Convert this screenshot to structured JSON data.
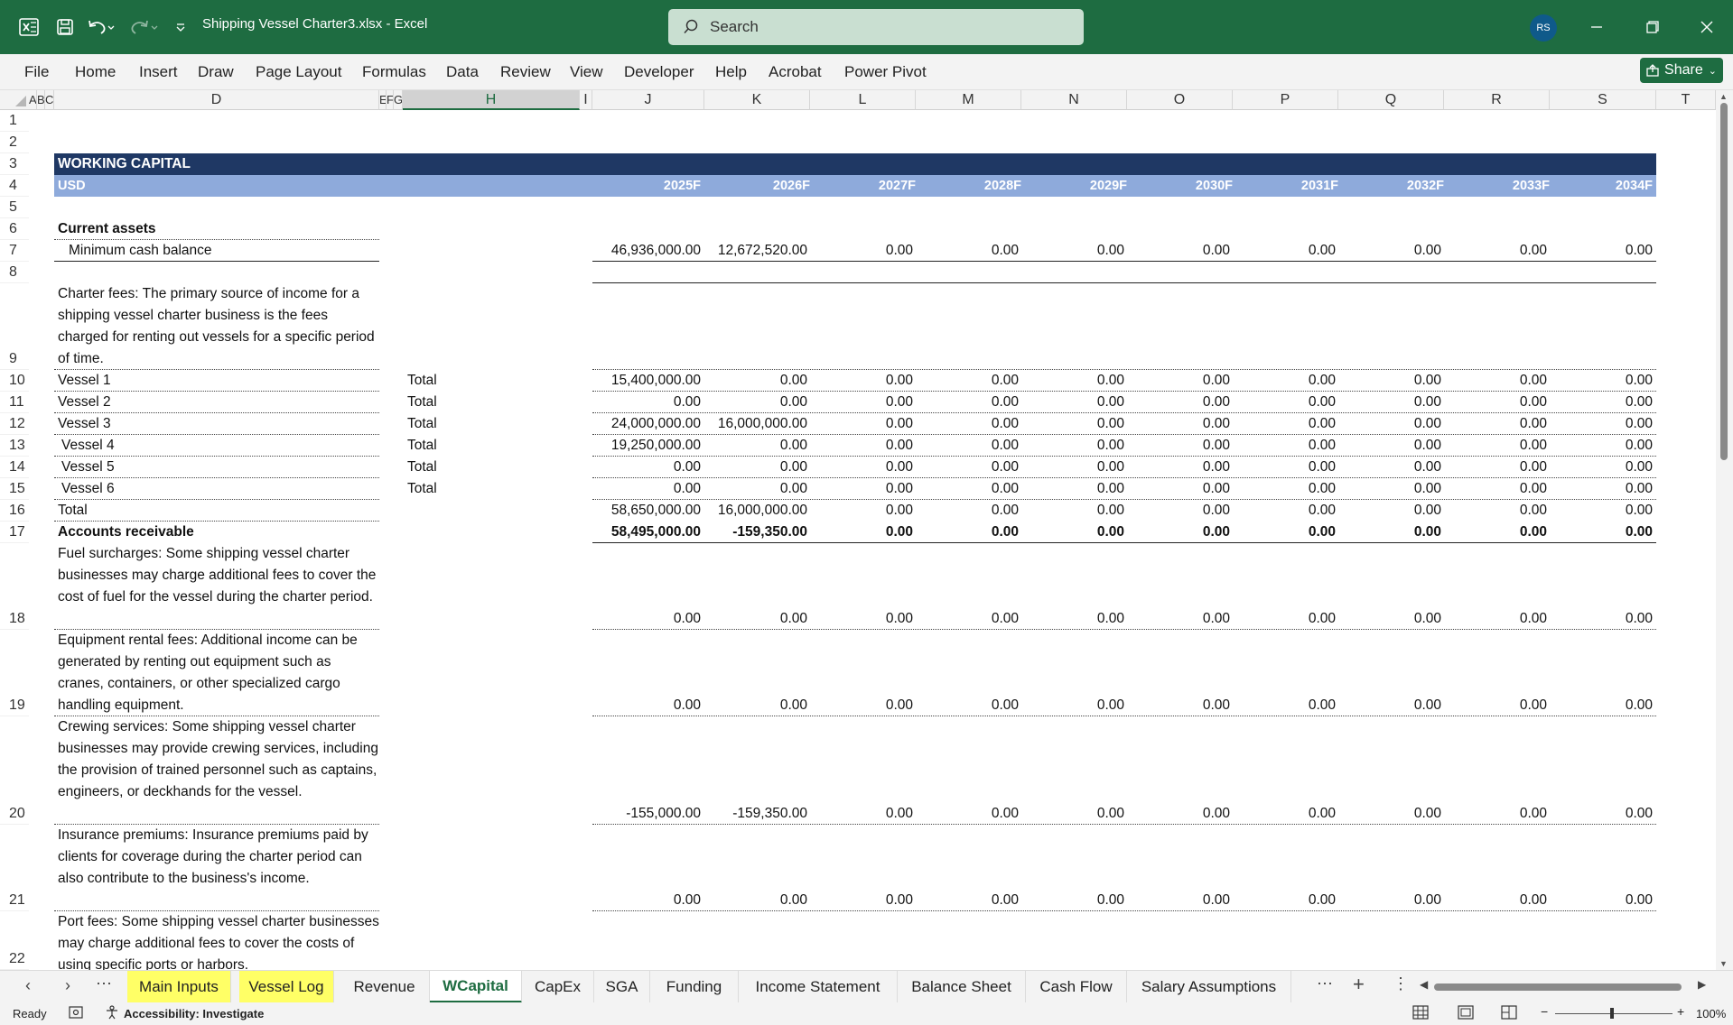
{
  "window": {
    "file_title": "Shipping Vessel Charter3.xlsx  -  Excel",
    "search_placeholder": "Search",
    "avatar_initials": "RS",
    "share_label": "Share"
  },
  "menu": [
    "File",
    "Home",
    "Insert",
    "Draw",
    "Page Layout",
    "Formulas",
    "Data",
    "Review",
    "View",
    "Developer",
    "Help",
    "Acrobat",
    "Power Pivot"
  ],
  "columns": [
    "A",
    "B",
    "C",
    "D",
    "E",
    "F",
    "G",
    "H",
    "I",
    "J",
    "K",
    "L",
    "M",
    "N",
    "O",
    "P",
    "Q",
    "R",
    "S",
    "T"
  ],
  "rows": [
    "1",
    "2",
    "3",
    "4",
    "5",
    "6",
    "7",
    "8",
    "9",
    "10",
    "11",
    "12",
    "13",
    "14",
    "15",
    "16",
    "17",
    "18",
    "19",
    "20",
    "21",
    "22"
  ],
  "sheet": {
    "header_title": "WORKING CAPITAL",
    "header_currency": "USD",
    "years": [
      "2025F",
      "2026F",
      "2027F",
      "2028F",
      "2029F",
      "2030F",
      "2031F",
      "2032F",
      "2033F",
      "2034F"
    ],
    "current_assets_label": "Current assets",
    "min_cash": {
      "label": "Minimum cash balance",
      "values": [
        "46,936,000.00",
        "12,672,520.00",
        "0.00",
        "0.00",
        "0.00",
        "0.00",
        "0.00",
        "0.00",
        "0.00",
        "0.00"
      ]
    },
    "charter_note": "Charter fees: The primary source of income for a shipping vessel charter business is the fees charged for renting out vessels for a specific period of time.",
    "vessels": [
      {
        "label": "Vessel 1",
        "h": "Total",
        "values": [
          "15,400,000.00",
          "0.00",
          "0.00",
          "0.00",
          "0.00",
          "0.00",
          "0.00",
          "0.00",
          "0.00",
          "0.00"
        ]
      },
      {
        "label": "Vessel 2",
        "h": "Total",
        "values": [
          "0.00",
          "0.00",
          "0.00",
          "0.00",
          "0.00",
          "0.00",
          "0.00",
          "0.00",
          "0.00",
          "0.00"
        ]
      },
      {
        "label": "Vessel 3",
        "h": "Total",
        "values": [
          "24,000,000.00",
          "16,000,000.00",
          "0.00",
          "0.00",
          "0.00",
          "0.00",
          "0.00",
          "0.00",
          "0.00",
          "0.00"
        ]
      },
      {
        "label": "Vessel 4",
        "h": "Total",
        "values": [
          "19,250,000.00",
          "0.00",
          "0.00",
          "0.00",
          "0.00",
          "0.00",
          "0.00",
          "0.00",
          "0.00",
          "0.00"
        ]
      },
      {
        "label": "Vessel 5",
        "h": "Total",
        "values": [
          "0.00",
          "0.00",
          "0.00",
          "0.00",
          "0.00",
          "0.00",
          "0.00",
          "0.00",
          "0.00",
          "0.00"
        ]
      },
      {
        "label": "Vessel 6",
        "h": "Total",
        "values": [
          "0.00",
          "0.00",
          "0.00",
          "0.00",
          "0.00",
          "0.00",
          "0.00",
          "0.00",
          "0.00",
          "0.00"
        ]
      }
    ],
    "total": {
      "label": "Total",
      "values": [
        "58,650,000.00",
        "16,000,000.00",
        "0.00",
        "0.00",
        "0.00",
        "0.00",
        "0.00",
        "0.00",
        "0.00",
        "0.00"
      ]
    },
    "ar": {
      "label": "Accounts receivable",
      "values": [
        "58,495,000.00",
        "-159,350.00",
        "0.00",
        "0.00",
        "0.00",
        "0.00",
        "0.00",
        "0.00",
        "0.00",
        "0.00"
      ]
    },
    "fuel": {
      "label": "Fuel surcharges: Some shipping vessel charter businesses may charge additional fees to cover the cost of fuel for the vessel during the charter period.",
      "values": [
        "0.00",
        "0.00",
        "0.00",
        "0.00",
        "0.00",
        "0.00",
        "0.00",
        "0.00",
        "0.00",
        "0.00"
      ]
    },
    "equip": {
      "label": "Equipment rental fees: Additional income can be generated by renting out equipment such as cranes, containers, or other specialized cargo handling equipment.",
      "values": [
        "0.00",
        "0.00",
        "0.00",
        "0.00",
        "0.00",
        "0.00",
        "0.00",
        "0.00",
        "0.00",
        "0.00"
      ]
    },
    "crew": {
      "label": "Crewing services: Some shipping vessel charter businesses may provide crewing services, including the provision of trained personnel such as captains, engineers, or deckhands for the vessel.",
      "values": [
        "-155,000.00",
        "-159,350.00",
        "0.00",
        "0.00",
        "0.00",
        "0.00",
        "0.00",
        "0.00",
        "0.00",
        "0.00"
      ]
    },
    "insurance": {
      "label": "Insurance premiums: Insurance premiums paid by clients for coverage during the charter period can also contribute to the business's income.",
      "values": [
        "0.00",
        "0.00",
        "0.00",
        "0.00",
        "0.00",
        "0.00",
        "0.00",
        "0.00",
        "0.00",
        "0.00"
      ]
    },
    "port": {
      "label": "Port fees: Some shipping vessel charter businesses may charge additional fees to cover the costs of using specific ports or harbors."
    }
  },
  "tabs": [
    "Main Inputs",
    "Vessel Log",
    "Revenue",
    "WCapital",
    "CapEx",
    "SGA",
    "Funding",
    "Income Statement",
    "Balance Sheet",
    "Cash Flow",
    "Salary Assumptions"
  ],
  "status": {
    "ready": "Ready",
    "accessibility": "Accessibility: Investigate",
    "zoom": "100%"
  }
}
